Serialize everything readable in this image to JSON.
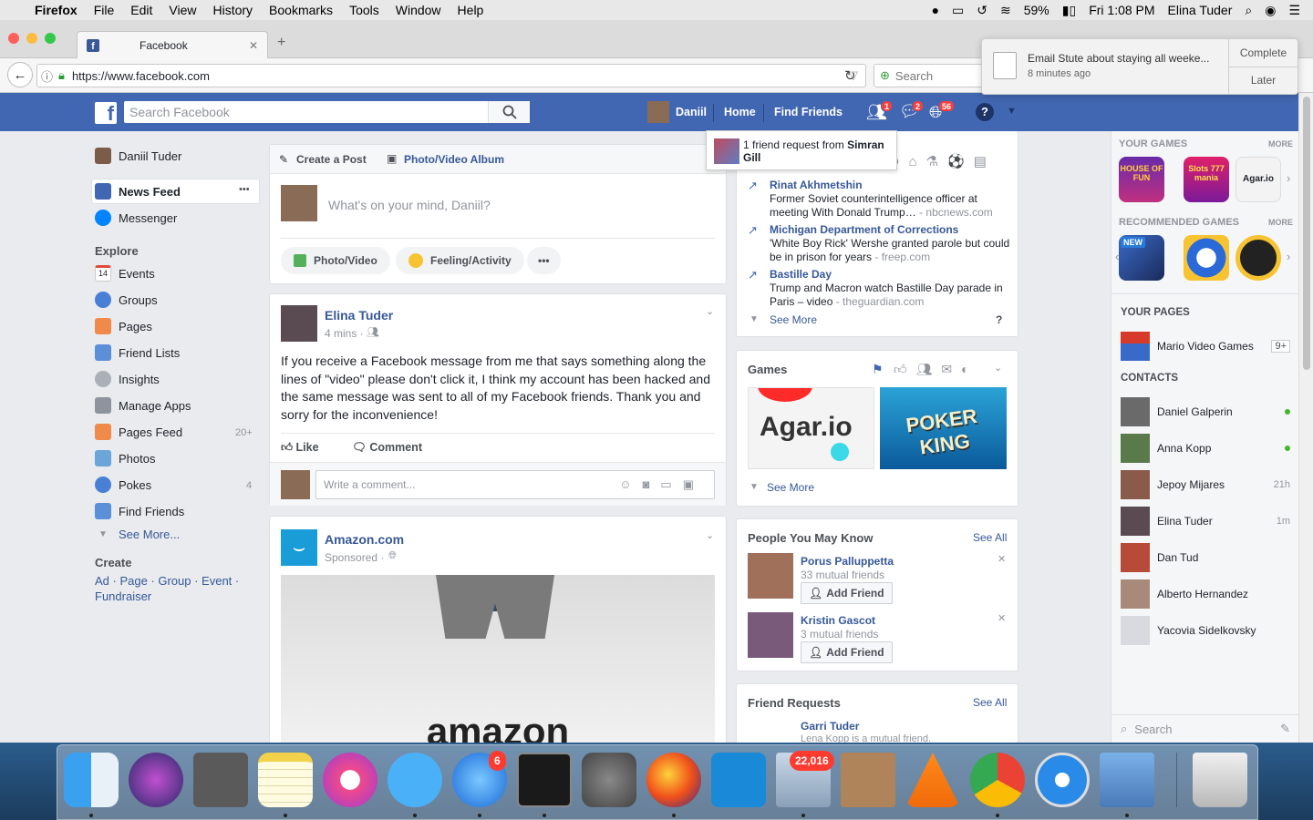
{
  "menubar": {
    "app": "Firefox",
    "items": [
      "File",
      "Edit",
      "View",
      "History",
      "Bookmarks",
      "Tools",
      "Window",
      "Help"
    ],
    "battery": "59%",
    "clock": "Fri 1:08 PM",
    "user": "Elina Tuder"
  },
  "browser": {
    "tab_title": "Facebook",
    "url": "https://www.facebook.com",
    "search_placeholder": "Search"
  },
  "notification": {
    "text": "Email Stute about staying all weeke...",
    "time": "8 minutes ago",
    "complete": "Complete",
    "later": "Later"
  },
  "fb_header": {
    "search_placeholder": "Search Facebook",
    "profile_name": "Daniil",
    "home": "Home",
    "find_friends": "Find Friends",
    "friend_badge": "1",
    "messages_badge": "2",
    "notif_badge": "56"
  },
  "friend_request_popup": {
    "prefix": "1 friend request from ",
    "name": "Simran Gill"
  },
  "left_nav": {
    "profile": "Daniil Tuder",
    "news_feed": "News Feed",
    "more_dots": "•••",
    "messenger": "Messenger",
    "explore": "Explore",
    "items": [
      {
        "label": "Events",
        "count": ""
      },
      {
        "label": "Groups",
        "count": ""
      },
      {
        "label": "Pages",
        "count": ""
      },
      {
        "label": "Friend Lists",
        "count": ""
      },
      {
        "label": "Insights",
        "count": ""
      },
      {
        "label": "Manage Apps",
        "count": ""
      },
      {
        "label": "Pages Feed",
        "count": "20+"
      },
      {
        "label": "Photos",
        "count": ""
      },
      {
        "label": "Pokes",
        "count": "4"
      },
      {
        "label": "Find Friends",
        "count": ""
      }
    ],
    "events_icon_text": "14",
    "see_more": "See More...",
    "create": "Create",
    "create_links": "Ad · Page · Group · Event ·",
    "fundraiser": "Fundraiser"
  },
  "composer": {
    "create_post": "Create a Post",
    "album": "Photo/Video Album",
    "placeholder": "What's on your mind, Daniil?",
    "photo_video": "Photo/Video",
    "feeling": "Feeling/Activity",
    "more": "•••"
  },
  "post1": {
    "author": "Elina Tuder",
    "time": "4 mins ·",
    "text": "If you receive a Facebook message from me that says something along the lines of \"video\" please don't click it, I think my account has been hacked and the same message was sent to all of my Facebook friends. Thank you and sorry for the inconvenience!",
    "like": "Like",
    "comment": "Comment",
    "comment_placeholder": "Write a comment..."
  },
  "post2": {
    "author": "Amazon.com",
    "meta": "Sponsored ·",
    "image_text": "amazon"
  },
  "trending": {
    "items": [
      {
        "title": "Rinat Akhmetshin",
        "desc": "Former Soviet counterintelligence officer at meeting With Donald Trump…",
        "source": " - nbcnews.com"
      },
      {
        "title": "Michigan Department of Corrections",
        "desc": "'White Boy Rick' Wershe granted parole but could be in prison for years",
        "source": " - freep.com"
      },
      {
        "title": "Bastille Day",
        "desc": "Trump and Macron watch Bastille Day parade in Paris – video",
        "source": " - theguardian.com"
      }
    ],
    "see_more": "See More",
    "help": "?"
  },
  "games": {
    "title": "Games",
    "tiles": [
      "Agar.io",
      "POKER KING"
    ],
    "see_more": "See More"
  },
  "pymk": {
    "title": "People You May Know",
    "see_all": "See All",
    "people": [
      {
        "name": "Porus Palluppetta",
        "mutual": "33 mutual friends",
        "add": "Add Friend"
      },
      {
        "name": "Kristin Gascot",
        "mutual": "3 mutual friends",
        "add": "Add Friend"
      }
    ]
  },
  "friend_requests": {
    "title": "Friend Requests",
    "see_all": "See All",
    "name": "Garri Tuder",
    "mutual": "Lena Kopp is a mutual friend."
  },
  "right_sidebar": {
    "your_games": "YOUR GAMES",
    "more": "MORE",
    "recommended": "RECOMMENDED GAMES",
    "game_labels": [
      "HOUSE OF FUN",
      "Slots 777 mania",
      "Agar.io"
    ],
    "new_label": "NEW",
    "your_pages": "YOUR PAGES",
    "page_name": "Mario Video Games",
    "page_count": "9+",
    "contacts_title": "CONTACTS",
    "contacts": [
      {
        "name": "Daniel Galperin",
        "status": "online"
      },
      {
        "name": "Anna Kopp",
        "status": "online"
      },
      {
        "name": "Jepoy Mijares",
        "status": "21h"
      },
      {
        "name": "Elina Tuder",
        "status": "1m"
      },
      {
        "name": "Dan Tud",
        "status": ""
      },
      {
        "name": "Alberto Hernandez",
        "status": ""
      },
      {
        "name": "Yacovia Sidelkovsky",
        "status": ""
      }
    ],
    "search_placeholder": "Search"
  },
  "dock": {
    "appstore_badge": "6",
    "mail_badge": "22,016"
  }
}
